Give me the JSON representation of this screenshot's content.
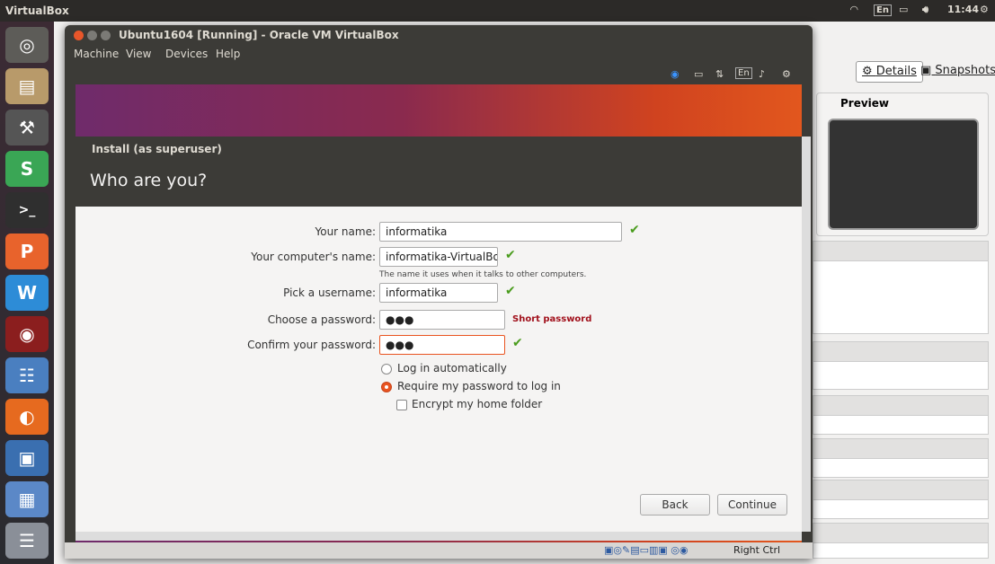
{
  "desktop": {
    "app_title": "VirtualBox",
    "time": "11:44",
    "keyboard_layout": "En"
  },
  "vbox_manager": {
    "tabs": [
      "Details",
      "Snapshots"
    ],
    "preview_label": "Preview"
  },
  "vm_window": {
    "title": "Ubuntu1604 [Running] - Oracle VM VirtualBox",
    "menu": [
      "Machine",
      "View",
      "Devices",
      "Help"
    ],
    "host_key": "Right Ctrl"
  },
  "installer": {
    "window_title": "Install (as superuser)",
    "heading": "Who are you?",
    "your_name_label": "Your name:",
    "your_name_value": "informatika",
    "computer_name_label": "Your computer's name:",
    "computer_name_value": "informatika-VirtualBo",
    "computer_name_hint": "The name it uses when it talks to other computers.",
    "username_label": "Pick a username:",
    "username_value": "informatika",
    "password_label": "Choose a password:",
    "password_value": "●●●",
    "password_strength": "Short password",
    "confirm_label": "Confirm your password:",
    "confirm_value": "●●●",
    "login_auto": "Log in automatically",
    "login_require": "Require my password to log in",
    "encrypt_home": "Encrypt my home folder",
    "selected_login_option": "Require my password to log in",
    "back_button": "Back",
    "continue_button": "Continue"
  },
  "colors": {
    "accent": "#e95420",
    "check_green": "#4a9c1d",
    "error_red": "#a1101b",
    "panel_dark": "#3c3b37"
  }
}
